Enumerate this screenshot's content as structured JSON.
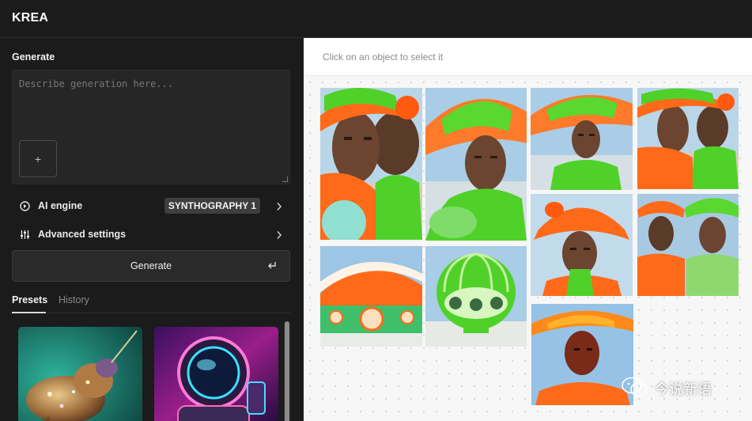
{
  "app": {
    "brand": "KREA"
  },
  "generate": {
    "section_title": "Generate",
    "prompt_placeholder": "Describe generation here...",
    "add_image_glyph": "+"
  },
  "engine": {
    "label": "AI engine",
    "value": "SYNTHOGRAPHY 1"
  },
  "advanced": {
    "label": "Advanced settings"
  },
  "generate_button": {
    "label": "Generate",
    "shortcut_glyph": "↵"
  },
  "tabs": [
    {
      "label": "Presets",
      "active": true
    },
    {
      "label": "History",
      "active": false
    }
  ],
  "presets": [
    {
      "subject": "jeweled insect"
    },
    {
      "subject": "neon astronaut"
    }
  ],
  "canvas": {
    "hint": "Click on an object to select it",
    "images": [
      {
        "subject": "two women in green and orange hats"
      },
      {
        "subject": "woman in wide green and orange hat"
      },
      {
        "subject": "woman in wide green and orange hat"
      },
      {
        "subject": "two women in green and orange hats"
      },
      {
        "subject": "woman in orange bucket hat"
      },
      {
        "subject": "two women in orange and green hats"
      },
      {
        "subject": "orange and green dome building"
      },
      {
        "subject": "green melon-shaped building"
      },
      {
        "subject": "woman in orange wide-brim hat"
      }
    ]
  },
  "watermark": {
    "text": "今说新语"
  },
  "colors": {
    "app_bg": "#1b1b1b",
    "panel_bg": "#262626",
    "canvas_bg": "#f7f7f7",
    "accent_orange": "#ff6a1a",
    "accent_green": "#4fd12a"
  }
}
